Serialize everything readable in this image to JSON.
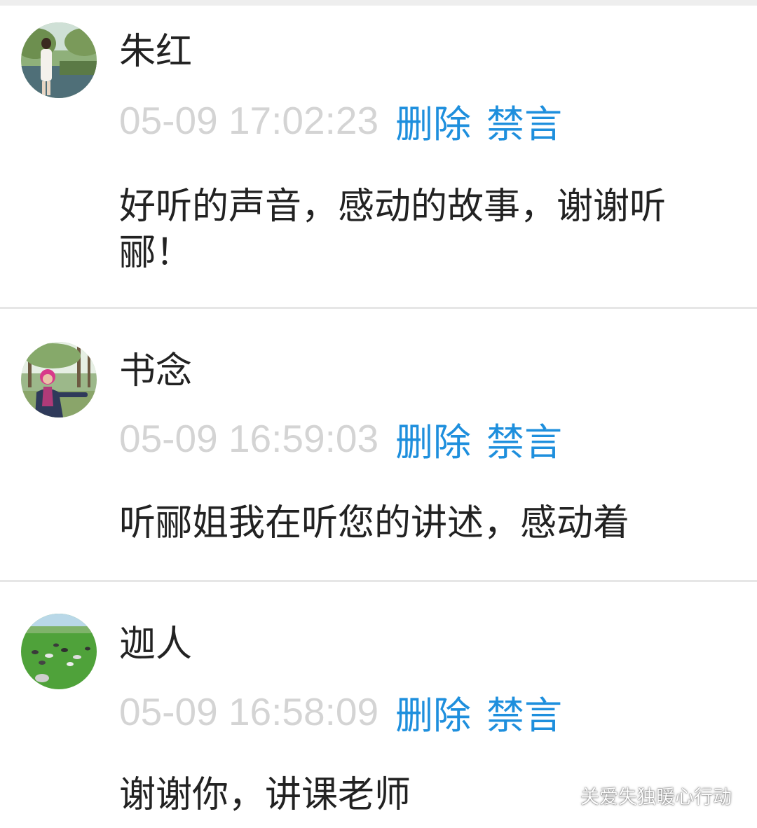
{
  "comments": [
    {
      "name": "朱红",
      "time": "05-09 17:02:23",
      "delete_label": "删除",
      "mute_label": "禁言",
      "text": "好听的声音，感动的故事，谢谢听郦！",
      "avatar_icon": "avatar-woman-by-lake"
    },
    {
      "name": "书念",
      "time": "05-09 16:59:03",
      "delete_label": "删除",
      "mute_label": "禁言",
      "text": "听郦姐我在听您的讲述，感动着",
      "avatar_icon": "avatar-woman-in-park"
    },
    {
      "name": "迦人",
      "time": "05-09 16:58:09",
      "delete_label": "删除",
      "mute_label": "禁言",
      "text": "谢谢你，讲课老师",
      "avatar_icon": "avatar-grassland-sheep"
    }
  ],
  "watermark": {
    "text": "关爱失独暖心行动",
    "icon": "wechat-logo-icon"
  },
  "colors": {
    "action_blue": "#1e8fdd",
    "timestamp_gray": "#d4d4d4",
    "divider_gray": "#e6e6e6",
    "text_dark": "#222222"
  }
}
